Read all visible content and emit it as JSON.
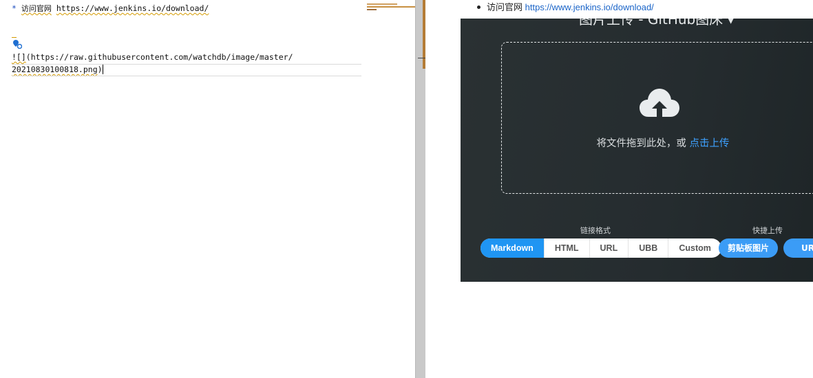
{
  "editor": {
    "line1": {
      "bullet": "*",
      "label": "访问官网",
      "url": "https://www.jenkins.io/download/"
    },
    "image_line": {
      "prefix": "![]",
      "url_part1": "(https://raw.githubusercontent.com/watchdb/image/master/",
      "url_part2": "20210830100818.png",
      "close": ")"
    }
  },
  "preview": {
    "bullet": {
      "label": "访问官网",
      "url": "https://www.jenkins.io/download/"
    },
    "uploader": {
      "title": "图片上传 - GitHub图床 ▾",
      "drop_text": "将文件拖到此处，或",
      "drop_link": "点击上传",
      "link_format_label": "链接格式",
      "quick_upload_label": "快捷上传",
      "formats": [
        "Markdown",
        "HTML",
        "URL",
        "UBB",
        "Custom"
      ],
      "active_format": "Markdown",
      "quick_buttons": [
        "剪贴板图片",
        "UR"
      ]
    }
  },
  "colors": {
    "accent": "#1f95f3",
    "link": "#1a64c8",
    "squiggle": "#d49a00",
    "panel": "#252c2f"
  },
  "icons": [
    "location-pin-icon",
    "cloud-upload-icon"
  ]
}
